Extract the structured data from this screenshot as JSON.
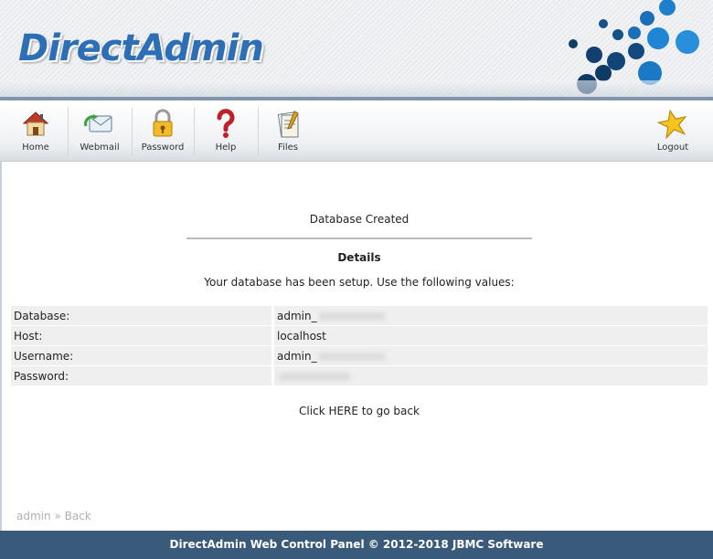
{
  "header": {
    "logo_text": "DirectAdmin",
    "accent": "#2c6fb7"
  },
  "toolbar": {
    "items": [
      {
        "label": "Home",
        "icon": "house-icon"
      },
      {
        "label": "Webmail",
        "icon": "mail-icon"
      },
      {
        "label": "Password",
        "icon": "padlock-icon"
      },
      {
        "label": "Help",
        "icon": "question-icon"
      },
      {
        "label": "Files",
        "icon": "files-icon"
      },
      {
        "label": "Logout",
        "icon": "star-icon"
      }
    ]
  },
  "main": {
    "title": "Database Created",
    "details_heading": "Details",
    "message": "Your database has been setup. Use the following values:",
    "rows": [
      {
        "key": "Database:",
        "value": "admin_",
        "redacted": true
      },
      {
        "key": "Host:",
        "value": "localhost",
        "redacted": false
      },
      {
        "key": "Username:",
        "value": "admin_",
        "redacted": true
      },
      {
        "key": "Password:",
        "value": "",
        "redacted": true
      }
    ],
    "back_link": "Click HERE to go back"
  },
  "breadcrumb": {
    "user": "admin",
    "separator": "»",
    "current": "Back"
  },
  "footer": {
    "text": "DirectAdmin Web Control Panel © 2012-2018 JBMC Software",
    "bg": "#3a5a7c"
  }
}
